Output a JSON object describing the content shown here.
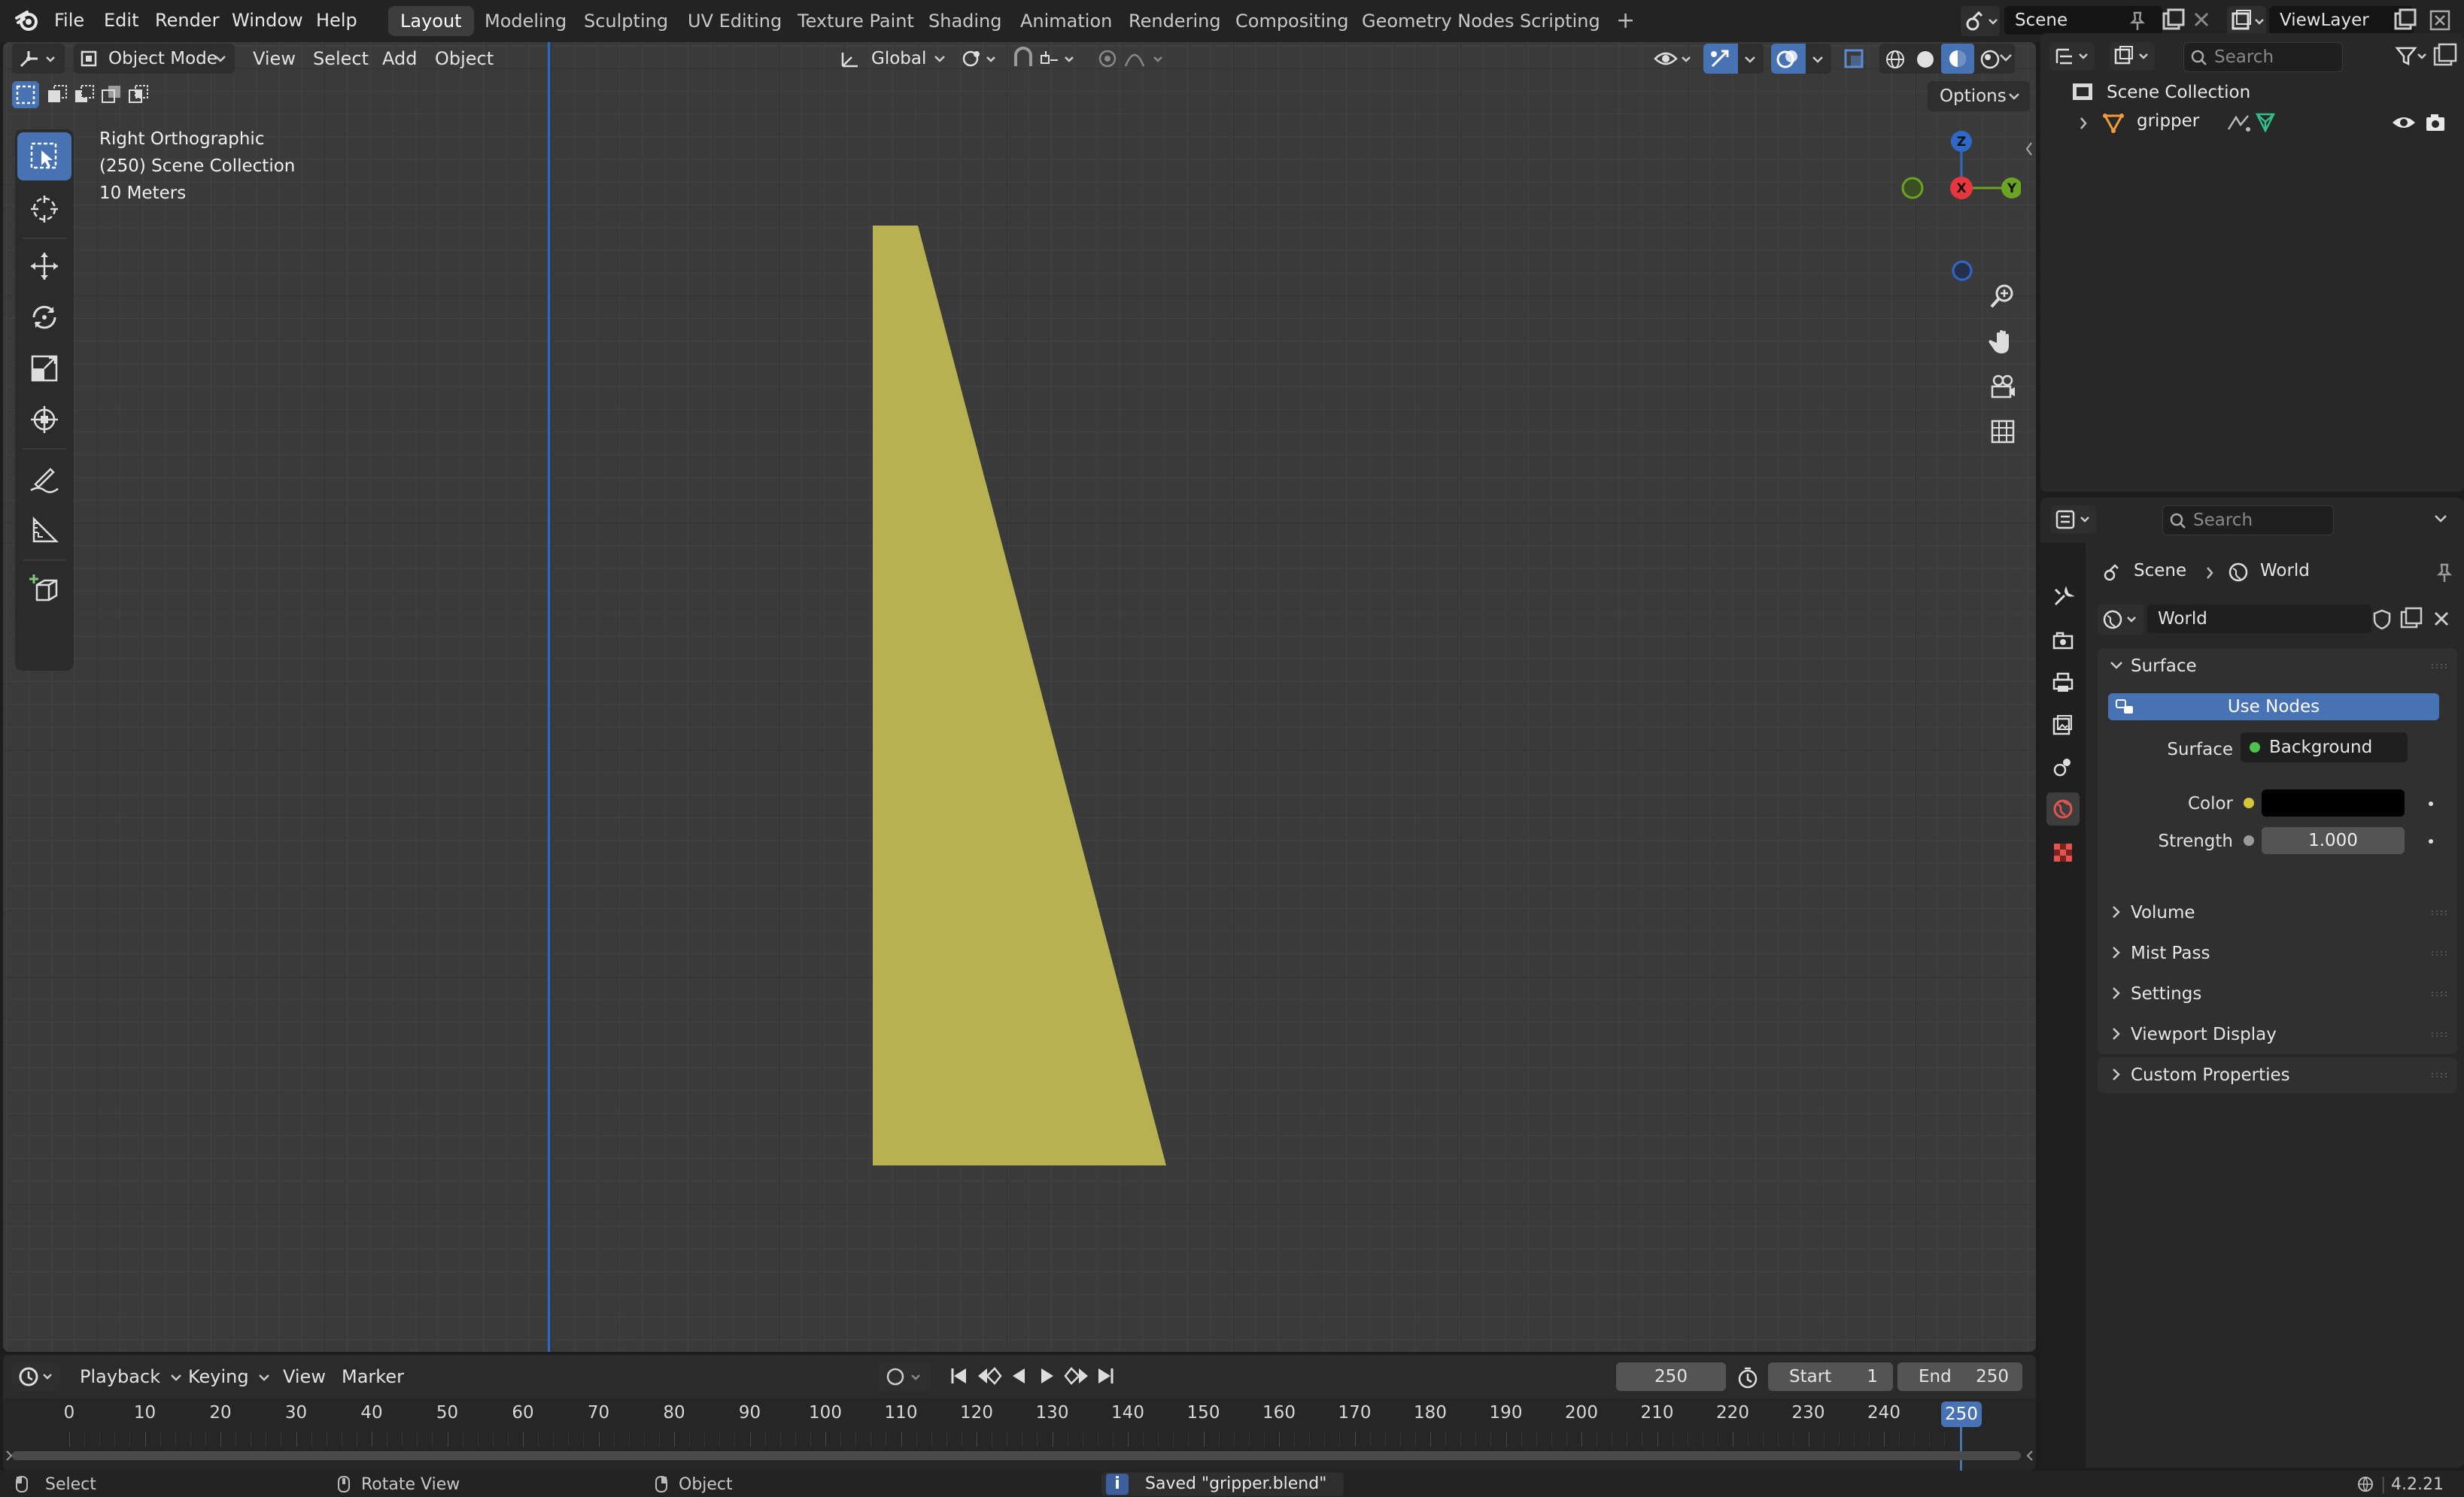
{
  "menubar": {
    "menus": [
      "File",
      "Edit",
      "Render",
      "Window",
      "Help"
    ],
    "workspaces": [
      "Layout",
      "Modeling",
      "Sculpting",
      "UV Editing",
      "Texture Paint",
      "Shading",
      "Animation",
      "Rendering",
      "Compositing",
      "Geometry Nodes",
      "Scripting"
    ],
    "active_workspace": "Layout",
    "add_workspace": "+",
    "scene_name": "Scene",
    "view_layer_name": "ViewLayer"
  },
  "viewport": {
    "mode": "Object Mode",
    "menus": [
      "View",
      "Select",
      "Add",
      "Object"
    ],
    "orientation": "Global",
    "options_label": "Options",
    "info_view": "Right Orthographic",
    "info_collection": "(250) Scene Collection",
    "info_scale": "10 Meters",
    "gizmo_axes": {
      "z": "Z",
      "x": "X",
      "y": "Y"
    },
    "object_color": "#b8b152",
    "axis_line_color": "#2e69c8"
  },
  "outliner": {
    "search_placeholder": "Search",
    "root": "Scene Collection",
    "items": [
      {
        "name": "gripper"
      }
    ]
  },
  "properties": {
    "search_placeholder": "Search",
    "breadcrumb": {
      "scene": "Scene",
      "world": "World"
    },
    "world_name": "World",
    "surface_panel": "Surface",
    "use_nodes_label": "Use Nodes",
    "surface_label": "Surface",
    "surface_value": "Background",
    "color_label": "Color",
    "color_value": "#000000",
    "strength_label": "Strength",
    "strength_value": "1.000",
    "panels": [
      "Volume",
      "Mist Pass",
      "Settings",
      "Viewport Display",
      "Custom Properties"
    ]
  },
  "timeline": {
    "menus": [
      "Playback",
      "Keying",
      "View",
      "Marker"
    ],
    "current_frame": "250",
    "start_label": "Start",
    "start_value": "1",
    "end_label": "End",
    "end_value": "250",
    "frame_labels": [
      "0",
      "10",
      "20",
      "30",
      "40",
      "50",
      "60",
      "70",
      "80",
      "90",
      "100",
      "110",
      "120",
      "130",
      "140",
      "150",
      "160",
      "170",
      "180",
      "190",
      "200",
      "210",
      "220",
      "230",
      "240",
      "250"
    ]
  },
  "statusbar": {
    "select": "Select",
    "rotate_view": "Rotate View",
    "object": "Object",
    "message": "Saved \"gripper.blend\"",
    "version": "4.2.21"
  }
}
